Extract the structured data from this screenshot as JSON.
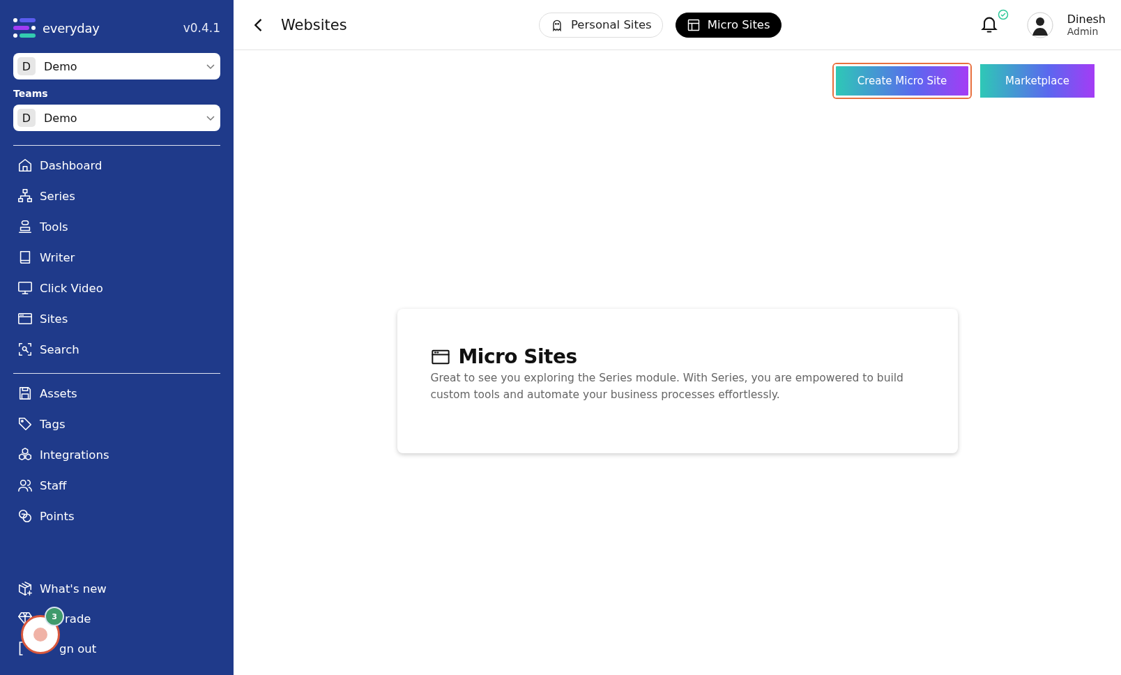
{
  "sidebar": {
    "logo_text": "everyday",
    "version": "v0.4.1",
    "workspace_select": {
      "initial": "D",
      "value": "Demo"
    },
    "teams_label": "Teams",
    "team_select": {
      "initial": "D",
      "value": "Demo"
    },
    "nav_groups": [
      [
        {
          "label": "Dashboard"
        },
        {
          "label": "Series"
        },
        {
          "label": "Tools"
        },
        {
          "label": "Writer"
        },
        {
          "label": "Click Video"
        },
        {
          "label": "Sites"
        },
        {
          "label": "Search"
        }
      ],
      [
        {
          "label": "Assets"
        },
        {
          "label": "Tags"
        },
        {
          "label": "Integrations"
        },
        {
          "label": "Staff"
        },
        {
          "label": "Points"
        }
      ]
    ],
    "bottom_items": [
      {
        "label": "What's new"
      },
      {
        "label": "rade",
        "covered": true
      },
      {
        "label": "gn out",
        "covered": true
      }
    ]
  },
  "header": {
    "title": "Websites",
    "tabs": [
      {
        "label": "Personal Sites",
        "selected": false
      },
      {
        "label": "Micro Sites",
        "selected": true
      }
    ],
    "user": {
      "name": "Dinesh",
      "role": "Admin"
    }
  },
  "actions": [
    {
      "label": "Create Micro Site",
      "focused": true
    },
    {
      "label": "Marketplace",
      "focused": false
    }
  ],
  "card": {
    "title": "Micro Sites",
    "text": "Great to see you exploring the Series module. With Series, you are empowered to build custom tools and automate your business processes effortlessly."
  },
  "floating_widget": {
    "badge": "3"
  }
}
